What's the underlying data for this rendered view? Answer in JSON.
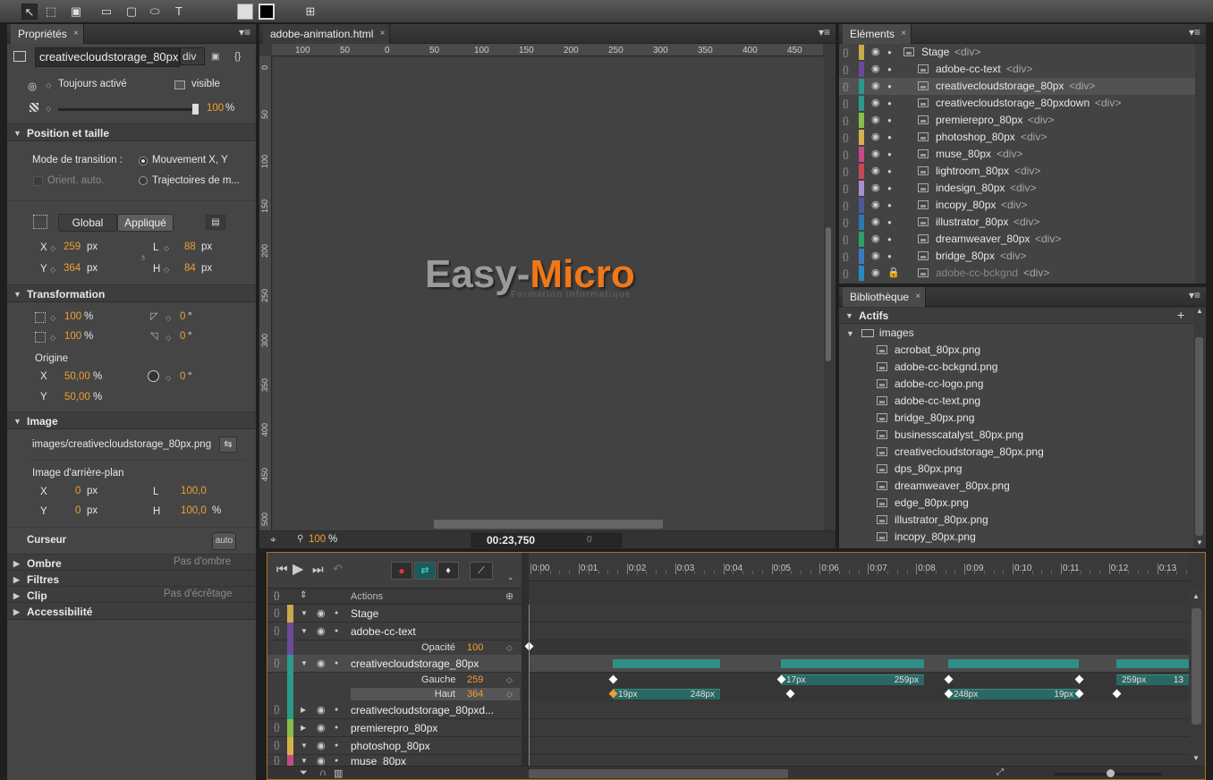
{
  "toolbar": {
    "tools": [
      "selection-tool",
      "transform-tool",
      "clipping-tool",
      "rectangle-tool",
      "rounded-rectangle-tool",
      "ellipse-tool",
      "text-tool"
    ],
    "text_tool_glyph": "T"
  },
  "properties": {
    "tab": "Propriétés",
    "element_name": "creativecloudstorage_80px",
    "element_type": "div",
    "visibility_option": "Toujours activé",
    "overflow_option": "visible",
    "opacity_value": "100",
    "opacity_unit": "%",
    "position_section": "Position et taille",
    "transition_mode_label": "Mode de transition :",
    "transition_xy": "Mouvement X, Y",
    "orient_auto": "Orient. auto.",
    "motion_paths": "Trajectoires de m...",
    "global_btn": "Global",
    "applied_btn": "Appliqué",
    "x_label": "X",
    "x_value": "259",
    "x_unit": "px",
    "y_label": "Y",
    "y_value": "364",
    "y_unit": "px",
    "w_label": "L",
    "w_value": "88",
    "w_unit": "px",
    "h_label": "H",
    "h_value": "84",
    "h_unit": "px",
    "transform_section": "Transformation",
    "scale_w": "100",
    "scale_h": "100",
    "scale_unit": "%",
    "skew": "0",
    "rotate": "0",
    "deg": "°",
    "origin_label": "Origine",
    "origin_x": "50,00",
    "origin_y": "50,00",
    "rotation_angle": "0",
    "image_section": "Image",
    "image_path": "images/creativecloudstorage_80px.png",
    "bg_image_label": "Image d'arrière-plan",
    "bg_x": "0",
    "bg_y": "0",
    "bg_unit": "px",
    "bg_w": "100,0",
    "bg_h": "100,0",
    "bg_pct": "%",
    "cursor_section": "Curseur",
    "cursor_value": "auto",
    "shadow_section": "Ombre",
    "shadow_value": "Pas d'ombre",
    "filters_section": "Filtres",
    "clip_section": "Clip",
    "clip_value": "Pas d'écrêtage",
    "accessibility_section": "Accessibilité"
  },
  "stage": {
    "tab": "adobe-animation.html",
    "ruler_h": [
      "100",
      "50",
      "0",
      "50",
      "100",
      "150",
      "200",
      "250",
      "300",
      "350",
      "400",
      "450"
    ],
    "ruler_v": [
      "0",
      "50",
      "100",
      "150",
      "200",
      "250",
      "300",
      "350",
      "400",
      "450",
      "500"
    ],
    "logo_part1": "Easy-",
    "logo_part2": "Micro",
    "logo_sub": "Formation informatique",
    "zoom": "100",
    "zoom_unit": "%",
    "timecode": "00:23,750",
    "frame": "0"
  },
  "elements": {
    "tab": "Eléments",
    "items": [
      {
        "name": "Stage",
        "tag": "<div>",
        "color": "#c9a94a"
      },
      {
        "name": "adobe-cc-text",
        "tag": "<div>",
        "color": "#6a4a9a"
      },
      {
        "name": "creativecloudstorage_80px",
        "tag": "<div>",
        "color": "#2a9a8a"
      },
      {
        "name": "creativecloudstorage_80pxdown",
        "tag": "<div>",
        "color": "#2a9a8a"
      },
      {
        "name": "premierepro_80px",
        "tag": "<div>",
        "color": "#8abd4a"
      },
      {
        "name": "photoshop_80px",
        "tag": "<div>",
        "color": "#d4b24a"
      },
      {
        "name": "muse_80px",
        "tag": "<div>",
        "color": "#c44a8a"
      },
      {
        "name": "lightroom_80px",
        "tag": "<div>",
        "color": "#c44a5a"
      },
      {
        "name": "indesign_80px",
        "tag": "<div>",
        "color": "#a890d0"
      },
      {
        "name": "incopy_80px",
        "tag": "<div>",
        "color": "#4a5a9a"
      },
      {
        "name": "illustrator_80px",
        "tag": "<div>",
        "color": "#2a7ab0"
      },
      {
        "name": "dreamweaver_80px",
        "tag": "<div>",
        "color": "#2aa06a"
      },
      {
        "name": "bridge_80px",
        "tag": "<div>",
        "color": "#3a7ac0"
      },
      {
        "name": "adobe-cc-bckgnd",
        "tag": "<div>",
        "color": "#2a8ac0"
      }
    ]
  },
  "library": {
    "tab": "Bibliothèque",
    "assets_label": "Actifs",
    "folder": "images",
    "files": [
      "acrobat_80px.png",
      "adobe-cc-bckgnd.png",
      "adobe-cc-logo.png",
      "adobe-cc-text.png",
      "bridge_80px.png",
      "businesscatalyst_80px.png",
      "creativecloudstorage_80px.png",
      "dps_80px.png",
      "dreamweaver_80px.png",
      "edge_80px.png",
      "illustrator_80px.png",
      "incopy_80px.png"
    ]
  },
  "timeline": {
    "ticks": [
      "0:00",
      "0:01",
      "0:02",
      "0:03",
      "0:04",
      "0:05",
      "0:06",
      "0:07",
      "0:08",
      "0:09",
      "0:10",
      "0:11",
      "0:12",
      "0:13"
    ],
    "actions_label": "Actions",
    "rows": [
      {
        "name": "Stage",
        "color": "#c9a94a"
      },
      {
        "name": "adobe-cc-text",
        "color": "#6a4a9a"
      },
      {
        "name": "creativecloudstorage_80px",
        "color": "#2a9a8a"
      },
      {
        "name": "creativecloudstorage_80pxd...",
        "color": "#2a9a8a"
      },
      {
        "name": "premierepro_80px",
        "color": "#8abd4a"
      },
      {
        "name": "photoshop_80px",
        "color": "#d4b24a"
      },
      {
        "name": "muse_80px",
        "color": "#c44a8a"
      }
    ],
    "opacity_label": "Opacité",
    "opacity_value": "100",
    "left_label": "Gauche",
    "left_value": "259",
    "top_label": "Haut",
    "top_value": "364",
    "bar_labels": [
      "17px",
      "259px",
      "259px",
      "13",
      "19px",
      "248px",
      "248px",
      "19px"
    ]
  }
}
